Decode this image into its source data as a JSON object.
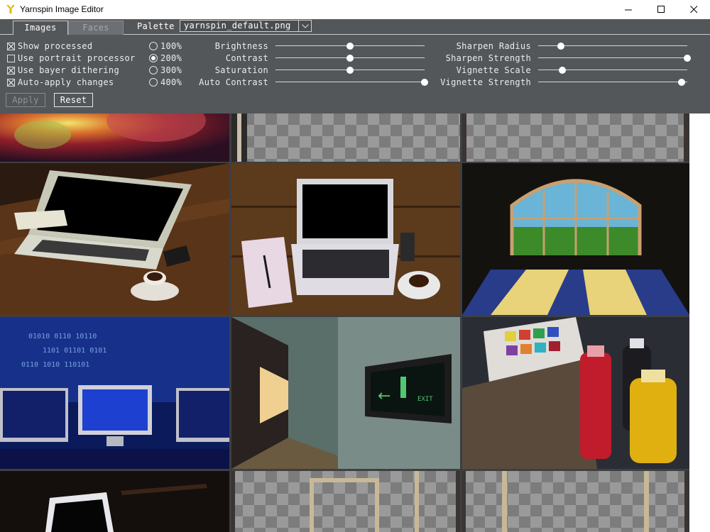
{
  "window": {
    "title": "Yarnspin Image Editor",
    "icon": "yarnspin-y-icon",
    "accent": "#e6b800"
  },
  "tabs": [
    {
      "label": "Images",
      "active": true
    },
    {
      "label": "Faces",
      "active": false
    }
  ],
  "palette": {
    "label": "Palette",
    "selected": "yarnspin_default.png"
  },
  "options": [
    {
      "label": "Show processed",
      "checked": true
    },
    {
      "label": "Use portrait processor",
      "checked": false
    },
    {
      "label": "Use bayer dithering",
      "checked": true
    },
    {
      "label": "Auto-apply changes",
      "checked": true
    }
  ],
  "zoom": [
    {
      "label": "100%",
      "selected": false
    },
    {
      "label": "200%",
      "selected": true
    },
    {
      "label": "300%",
      "selected": false
    },
    {
      "label": "400%",
      "selected": false
    }
  ],
  "sliders_left": [
    {
      "label": "Brightness",
      "value": 0.5
    },
    {
      "label": "Contrast",
      "value": 0.5
    },
    {
      "label": "Saturation",
      "value": 0.5
    },
    {
      "label": "Auto Contrast",
      "value": 1.0
    }
  ],
  "sliders_right": [
    {
      "label": "Sharpen Radius",
      "value": 0.15
    },
    {
      "label": "Sharpen Strength",
      "value": 1.0
    },
    {
      "label": "Vignette Scale",
      "value": 0.16
    },
    {
      "label": "Vignette Strength",
      "value": 0.96
    }
  ],
  "buttons": {
    "apply": "Apply",
    "reset": "Reset"
  },
  "colors": {
    "panel_bg": "#53575a",
    "grid_bg": "#3d3f41"
  },
  "images": [
    {
      "name": "thumb-galaxy",
      "kind": "galaxy"
    },
    {
      "name": "thumb-transparent",
      "kind": "checker"
    },
    {
      "name": "thumb-transparent",
      "kind": "checker"
    },
    {
      "name": "thumb-laptop-table",
      "kind": "laptop-dark"
    },
    {
      "name": "thumb-laptop-desk",
      "kind": "laptop-wood"
    },
    {
      "name": "thumb-arched-window",
      "kind": "window-room"
    },
    {
      "name": "thumb-binary-monitors",
      "kind": "binary"
    },
    {
      "name": "thumb-exit-sign",
      "kind": "corridor"
    },
    {
      "name": "thumb-paint-bottles",
      "kind": "paints"
    },
    {
      "name": "thumb-tablet",
      "kind": "tablet"
    },
    {
      "name": "thumb-door-frame",
      "kind": "checker-frame"
    },
    {
      "name": "thumb-pillars",
      "kind": "checker-pillars"
    }
  ]
}
